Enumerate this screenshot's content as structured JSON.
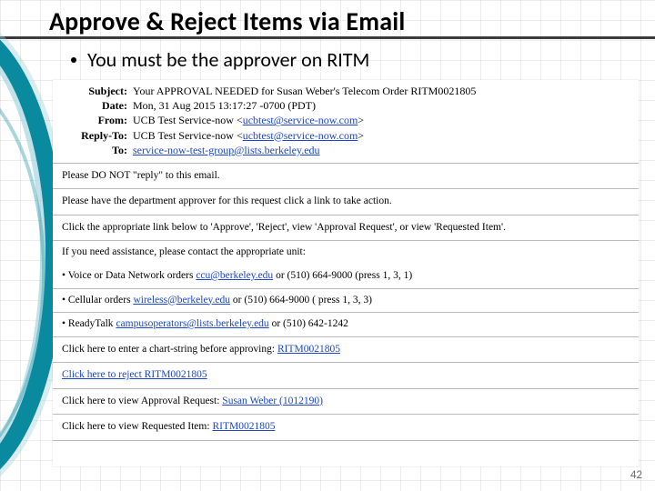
{
  "title": "Approve & Reject Items via Email",
  "bullet": "You must be the approver on RITM",
  "page_number": "42",
  "email": {
    "header": {
      "subject_label": "Subject:",
      "subject_value": "Your APPROVAL NEEDED for Susan Weber's Telecom Order RITM0021805",
      "date_label": "Date:",
      "date_value": "Mon, 31 Aug 2015 13:17:27 -0700 (PDT)",
      "from_label": "From:",
      "from_name": "UCB Test Service-now ",
      "from_email": "ucbtest@service-now.com",
      "replyto_label": "Reply-To:",
      "replyto_name": "UCB Test Service-now ",
      "replyto_email": "ucbtest@service-now.com",
      "to_label": "To:",
      "to_email": "service-now-test-group@lists.berkeley.edu"
    },
    "body": {
      "line1": "Please DO NOT \"reply\" to this email.",
      "line2": "Please have the department approver for this request click a link to take action.",
      "line3": "Click the appropriate link below to 'Approve', 'Reject', view 'Approval Request', or view 'Requested Item'.",
      "line4": "If you need assistance, please contact the appropriate unit:",
      "voice_pre": "• Voice or Data Network orders ",
      "voice_email": "ccu@berkeley.edu",
      "voice_post": " or (510) 664-9000 (press 1, 3, 1)",
      "cell_pre": "• Cellular orders ",
      "cell_email": "wireless@berkeley.edu",
      "cell_post": " or (510) 664-9000 ( press 1, 3, 3)",
      "ready_pre": "• ReadyTalk ",
      "ready_email": "campusoperators@lists.berkeley.edu",
      "ready_post": " or (510) 642-1242",
      "approve_pre": "Click here to enter a chart-string before approving: ",
      "approve_link": "RITM0021805",
      "reject_link": "Click here to reject RITM0021805",
      "viewreq_pre": "Click here to view Approval Request: ",
      "viewreq_link": "Susan Weber (1012190)",
      "viewitem_pre": "Click here to view Requested Item: ",
      "viewitem_link": "RITM0021805"
    }
  }
}
